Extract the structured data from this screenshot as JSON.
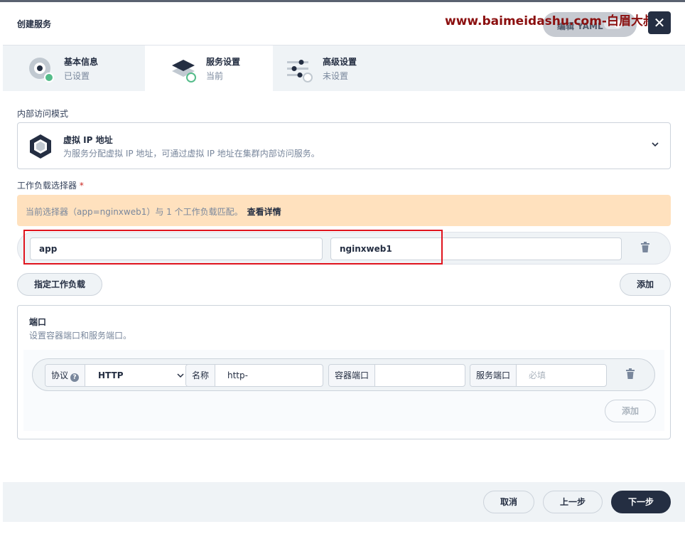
{
  "header": {
    "title": "创建服务",
    "watermark": "www.baimeidashu.com-白眉大叔",
    "edit_yaml": "编辑 YAML",
    "close": "✕"
  },
  "steps": [
    {
      "title": "基本信息",
      "status": "已设置"
    },
    {
      "title": "服务设置",
      "status": "当前"
    },
    {
      "title": "高级设置",
      "status": "未设置"
    }
  ],
  "access_mode": {
    "label": "内部访问模式",
    "title": "虚拟 IP 地址",
    "description": "为服务分配虚拟 IP 地址，可通过虚拟 IP 地址在集群内部访问服务。"
  },
  "workload_selector": {
    "label": "工作负载选择器",
    "required_mark": "*",
    "notice": "当前选择器（app=nginxweb1）与 1 个工作负载匹配。",
    "notice_link": "查看详情",
    "key": "app",
    "value": "nginxweb1",
    "specify_button": "指定工作负载",
    "add_button": "添加"
  },
  "ports": {
    "title": "端口",
    "description": "设置容器端口和服务端口。",
    "protocol_label": "协议",
    "protocol_help": "?",
    "protocol_value": "HTTP",
    "name_label": "名称",
    "name_value": "http-",
    "container_port_label": "容器端口",
    "container_port_value": "",
    "service_port_label": "服务端口",
    "service_port_placeholder": "必填",
    "add_button": "添加"
  },
  "footer": {
    "cancel": "取消",
    "prev": "上一步",
    "next": "下一步"
  },
  "colors": {
    "primary_dark": "#242e42",
    "success": "#55bc8a",
    "warning_bg": "#ffe1be",
    "highlight": "#e0141e"
  }
}
